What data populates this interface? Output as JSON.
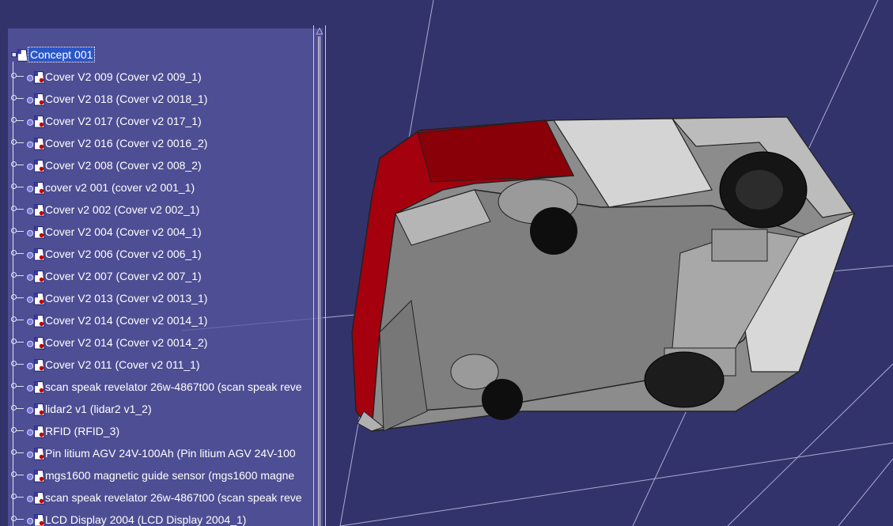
{
  "tree": {
    "root_label": "Concept 001",
    "items": [
      {
        "label": "Cover V2 009 (Cover v2 009_1)"
      },
      {
        "label": "Cover V2 018 (Cover v2 0018_1)"
      },
      {
        "label": "Cover V2 017 (Cover v2 017_1)"
      },
      {
        "label": "Cover V2 016 (Cover v2 0016_2)"
      },
      {
        "label": "Cover V2 008 (Cover v2 008_2)"
      },
      {
        "label": "cover v2 001 (cover v2 001_1)"
      },
      {
        "label": "Cover v2 002 (Cover v2 002_1)"
      },
      {
        "label": "Cover V2 004 (Cover v2 004_1)"
      },
      {
        "label": "Cover V2 006 (Cover v2 006_1)"
      },
      {
        "label": "Cover V2 007 (Cover v2 007_1)"
      },
      {
        "label": "Cover V2 013 (Cover v2 0013_1)"
      },
      {
        "label": "Cover V2 014 (Cover v2 0014_1)"
      },
      {
        "label": "Cover V2 014 (Cover v2 0014_2)"
      },
      {
        "label": "Cover V2 011 (Cover v2 011_1)"
      },
      {
        "label": "scan speak revelator 26w-4867t00 (scan speak reve"
      },
      {
        "label": "lidar2 v1 (lidar2 v1_2)"
      },
      {
        "label": "RFID (RFID_3)"
      },
      {
        "label": "Pin litium AGV 24V-100Ah (Pin litium AGV 24V-100"
      },
      {
        "label": "mgs1600 magnetic guide sensor (mgs1600 magne"
      },
      {
        "label": "scan speak revelator 26w-4867t00 (scan speak reve"
      },
      {
        "label": "LCD Display 2004 (LCD Display 2004_1)"
      }
    ]
  },
  "icons": {
    "root": "product-icon",
    "item": "part-instance-icon",
    "scroll_up": "scroll-up-arrow-icon"
  },
  "colors": {
    "background": "#33336b",
    "tree_panel": "#5656a0",
    "selection": "#2b56c8",
    "red_cover": "#a4000e",
    "grey_body": "#8e8e8e"
  }
}
